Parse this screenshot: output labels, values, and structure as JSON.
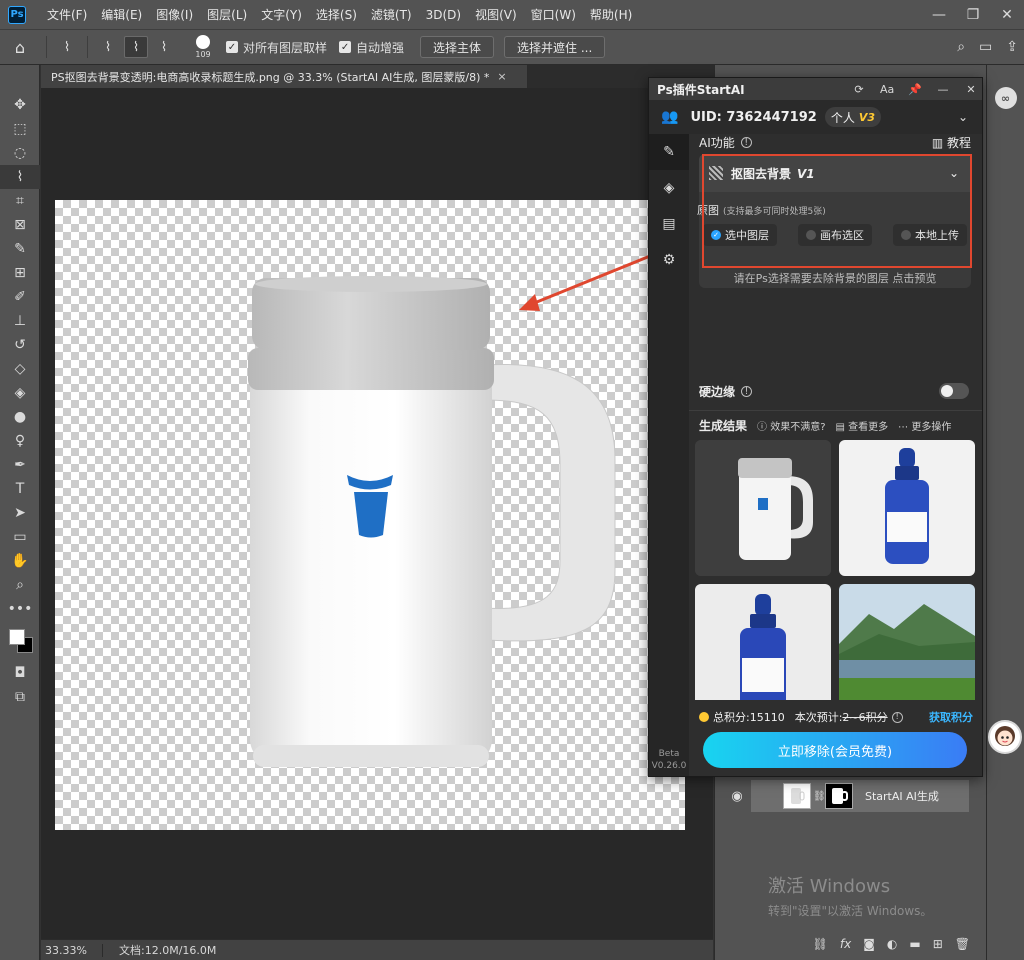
{
  "menubar": {
    "logo": "Ps",
    "items": [
      "文件(F)",
      "编辑(E)",
      "图像(I)",
      "图层(L)",
      "文字(Y)",
      "选择(S)",
      "滤镜(T)",
      "3D(D)",
      "视图(V)",
      "窗口(W)",
      "帮助(H)"
    ],
    "controls": [
      "—",
      "❐",
      "✕"
    ]
  },
  "optbar": {
    "brush_size": "109",
    "sample_all_layers": "对所有图层取样",
    "auto_enhance": "自动增强",
    "select_subject": "选择主体",
    "select_and_mask": "选择并遮住 ..."
  },
  "document": {
    "tab_title": "PS抠图去背景变透明:电商高收录标题生成.png @ 33.3% (StartAI AI生成, 图层蒙版/8) *",
    "close": "×"
  },
  "status": {
    "zoom": "33.33%",
    "doc_size": "文档:12.0M/16.0M"
  },
  "plugin": {
    "title": "Ps插件StartAI",
    "header_icons": [
      "⟳",
      "Aa",
      "📌",
      "—",
      "✕"
    ],
    "uid": "UID: 7362447192",
    "account_type": "个人",
    "account_level": "V3",
    "ai_features_label": "AI功能",
    "tutorial": "教程",
    "feature_name": "抠图去背景",
    "feature_version": "V1",
    "source_label": "原图",
    "source_hint": "(支持最多可同时处理5张)",
    "source_options": [
      "选中图层",
      "画布选区",
      "本地上传"
    ],
    "instruction": "请在Ps选择需要去除背景的图层 点击预览",
    "hard_edge_label": "硬边缘",
    "results_label": "生成结果",
    "unsatisfied": "效果不满意?",
    "view_more": "查看更多",
    "more_actions": "更多操作",
    "total_credits": "总积分:15110",
    "estimate_label": "本次预计:",
    "estimate_value": "2~6积分",
    "get_credits": "获取积分",
    "remove_button": "立即移除(会员免费)",
    "beta": "Beta",
    "version": "V0.26.0"
  },
  "layers": {
    "layer_name": "StartAI AI生成"
  },
  "watermark": {
    "line1": "激活 Windows",
    "line2": "转到\"设置\"以激活 Windows。"
  },
  "colors": {
    "accent_blue": "#2aa4ff",
    "highlight_red": "#e0472f",
    "coin_yellow": "#ffc933",
    "cta_gradient_start": "#18d4f0",
    "cta_gradient_end": "#3a7cf5"
  }
}
